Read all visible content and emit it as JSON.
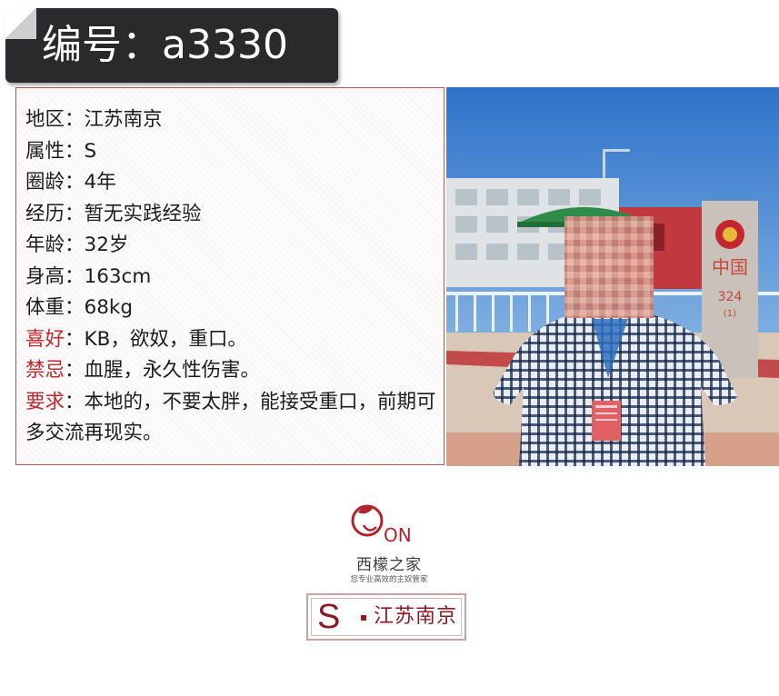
{
  "header": {
    "title": "编号：a3330"
  },
  "profile": {
    "rows": [
      {
        "label": "地区：",
        "value": "江苏南京",
        "highlight": false
      },
      {
        "label": "属性：",
        "value": "S",
        "highlight": false
      },
      {
        "label": "圈龄：",
        "value": "4年",
        "highlight": false
      },
      {
        "label": "经历：",
        "value": "暂无实践经验",
        "highlight": false
      },
      {
        "label": "年龄：",
        "value": "32岁",
        "highlight": false
      },
      {
        "label": "身高：",
        "value": "163cm",
        "highlight": false
      },
      {
        "label": "体重：",
        "value": "68kg",
        "highlight": false
      },
      {
        "label": "喜好",
        "sep": "：",
        "value": "KB，欲奴，重口。",
        "highlight": true
      },
      {
        "label": "禁忌",
        "sep": "：",
        "value": "血腥，永久性伤害。",
        "highlight": true
      },
      {
        "label": "要求",
        "sep": "：",
        "value": "本地的，不要太胖，能接受重口，前期可多交流再现实。",
        "highlight": true
      }
    ]
  },
  "photo": {
    "border_stone_text": "中国",
    "border_stone_number": "324",
    "border_stone_sub": "(1)"
  },
  "logo": {
    "mark": "ON",
    "brand": "西檬之家",
    "slogan": "您专业高效的主奴管家"
  },
  "badge": {
    "letter": "S",
    "city": "江苏南京"
  },
  "colors": {
    "accent_red": "#c1272d",
    "badge_red": "#8b1a24",
    "header_bg": "#2a2a2c"
  }
}
